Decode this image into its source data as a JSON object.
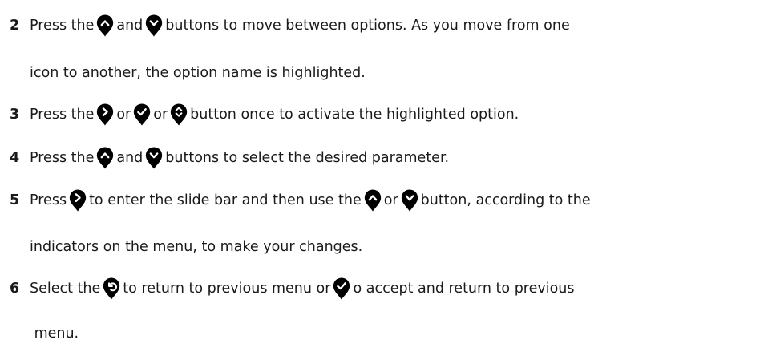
{
  "steps": [
    {
      "number": "2",
      "lines": [
        [
          {
            "text": "Press the "
          },
          {
            "icon": "up"
          },
          {
            "text": " and "
          },
          {
            "icon": "down"
          },
          {
            "text": " buttons to move between options. As you move from one"
          }
        ],
        [
          {
            "text": "icon to another, the option name is highlighted."
          }
        ]
      ]
    },
    {
      "number": "3",
      "lines": [
        [
          {
            "text": "Press the "
          },
          {
            "icon": "right"
          },
          {
            "text": " or "
          },
          {
            "icon": "check"
          },
          {
            "text": " or "
          },
          {
            "icon": "updown"
          },
          {
            "text": " button once to activate the highlighted option."
          }
        ]
      ]
    },
    {
      "number": "4",
      "lines": [
        [
          {
            "text": "Press the "
          },
          {
            "icon": "up"
          },
          {
            "text": " and "
          },
          {
            "icon": "down"
          },
          {
            "text": " buttons to select the desired parameter."
          }
        ]
      ]
    },
    {
      "number": "5",
      "lines": [
        [
          {
            "text": "Press "
          },
          {
            "icon": "right"
          },
          {
            "text": " to enter the slide bar and then use the "
          },
          {
            "icon": "up"
          },
          {
            "text": " or "
          },
          {
            "icon": "down"
          },
          {
            "text": " button, according to the"
          }
        ],
        [
          {
            "text": "indicators on the menu, to make your changes."
          }
        ]
      ]
    },
    {
      "number": "6",
      "lines": [
        [
          {
            "text": "Select the "
          },
          {
            "icon": "back"
          },
          {
            "text": " to return to previous menu or "
          },
          {
            "icon": "check"
          },
          {
            "text": " o accept and return to previous"
          }
        ],
        [
          {
            "text": " menu."
          }
        ]
      ]
    }
  ]
}
